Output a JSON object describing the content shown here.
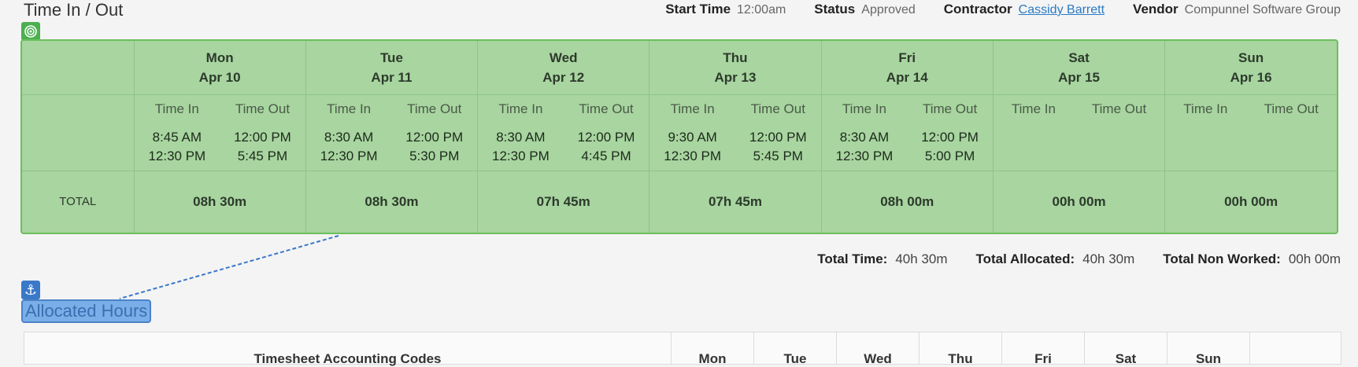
{
  "header": {
    "title": "Time In / Out",
    "start_time_label": "Start Time",
    "start_time_value": "12:00am",
    "status_label": "Status",
    "status_value": "Approved",
    "contractor_label": "Contractor",
    "contractor_value": "Cassidy Barrett",
    "vendor_label": "Vendor",
    "vendor_value": "Compunnel Software Group"
  },
  "icons": {
    "target": "target-icon",
    "anchor": "anchor-icon"
  },
  "colors": {
    "panel_bg": "#a8d5a0",
    "panel_border": "#6cbf5e",
    "link": "#2a7ac4",
    "selection": "#7aaee8"
  },
  "grid": {
    "time_in_label": "Time In",
    "time_out_label": "Time Out",
    "total_label": "TOTAL",
    "days": [
      {
        "day": "Mon",
        "date": "Apr 10",
        "in1": "8:45 AM",
        "out1": "12:00 PM",
        "in2": "12:30 PM",
        "out2": "5:45 PM",
        "total": "08h 30m"
      },
      {
        "day": "Tue",
        "date": "Apr 11",
        "in1": "8:30 AM",
        "out1": "12:00 PM",
        "in2": "12:30 PM",
        "out2": "5:30 PM",
        "total": "08h 30m"
      },
      {
        "day": "Wed",
        "date": "Apr 12",
        "in1": "8:30 AM",
        "out1": "12:00 PM",
        "in2": "12:30 PM",
        "out2": "4:45 PM",
        "total": "07h 45m"
      },
      {
        "day": "Thu",
        "date": "Apr 13",
        "in1": "9:30 AM",
        "out1": "12:00 PM",
        "in2": "12:30 PM",
        "out2": "5:45 PM",
        "total": "07h 45m"
      },
      {
        "day": "Fri",
        "date": "Apr 14",
        "in1": "8:30 AM",
        "out1": "12:00 PM",
        "in2": "12:30 PM",
        "out2": "5:00 PM",
        "total": "08h 00m"
      },
      {
        "day": "Sat",
        "date": "Apr 15",
        "in1": "",
        "out1": "",
        "in2": "",
        "out2": "",
        "total": "00h 00m"
      },
      {
        "day": "Sun",
        "date": "Apr 16",
        "in1": "",
        "out1": "",
        "in2": "",
        "out2": "",
        "total": "00h 00m"
      }
    ]
  },
  "totals": {
    "total_time_label": "Total Time:",
    "total_time_value": "40h 30m",
    "total_allocated_label": "Total Allocated:",
    "total_allocated_value": "40h 30m",
    "total_non_worked_label": "Total Non Worked:",
    "total_non_worked_value": "00h 00m"
  },
  "allocated": {
    "title": "Allocated Hours",
    "columns": [
      "Timesheet Accounting Codes",
      "Mon",
      "Tue",
      "Wed",
      "Thu",
      "Fri",
      "Sat",
      "Sun"
    ]
  }
}
